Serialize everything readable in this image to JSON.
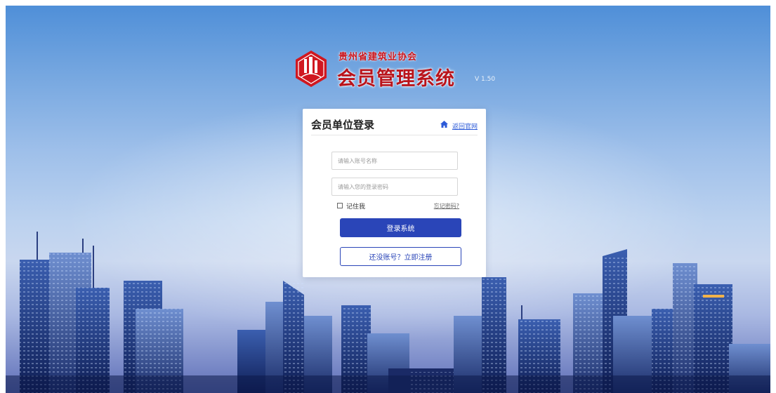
{
  "logo": {
    "emblem": "association-emblem-icon",
    "subtitle": "贵州省建筑业协会",
    "title": "会员管理系统",
    "version": "V 1.50"
  },
  "login": {
    "title": "会员单位登录",
    "back_icon": "home-icon",
    "back_label": "返回官网",
    "username_placeholder": "请输入账号名称",
    "password_placeholder": "请输入您的登录密码",
    "remember_label": "记住我",
    "forgot_label": "忘记密码?",
    "submit_label": "登录系统",
    "register_label": "还没账号？立即注册"
  },
  "colors": {
    "brand_red": "#c8141c",
    "primary_blue": "#2a45b8",
    "link_blue": "#2d5bd8"
  }
}
